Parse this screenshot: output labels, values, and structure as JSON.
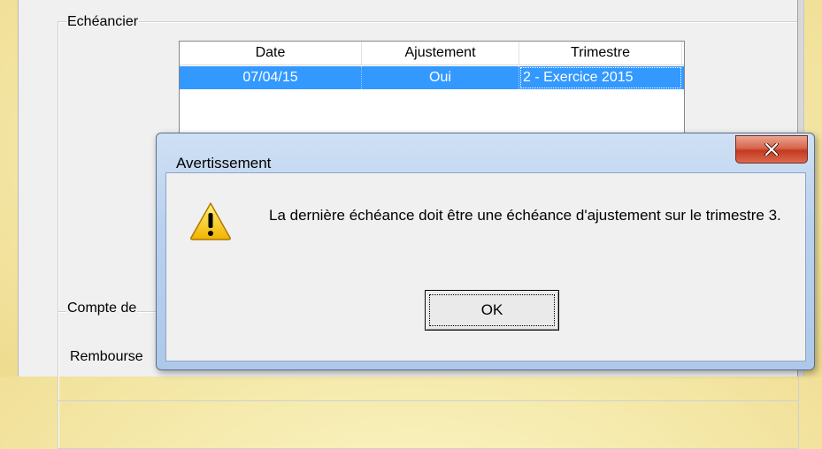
{
  "background_window": {
    "schedule_group": {
      "legend": "Echéancier",
      "table": {
        "columns": [
          "Date",
          "Ajustement",
          "Trimestre"
        ],
        "rows": [
          {
            "date": "07/04/15",
            "ajustement": "Oui",
            "trimestre": "2 - Exercice 2015",
            "selected": true
          }
        ]
      }
    },
    "account_group": {
      "legend": "Compte de"
    },
    "repayment_label": "Rembourse"
  },
  "dialog": {
    "title": "Avertissement",
    "close_icon": "close-icon",
    "warning_icon": "warning-icon",
    "message": "La dernière échéance doit être une échéance d'ajustement sur le trimestre 3.",
    "ok_label": "OK",
    "colors": {
      "selection": "#3399ff",
      "close": "#c4391f",
      "frame": "#b9d1ee"
    }
  }
}
